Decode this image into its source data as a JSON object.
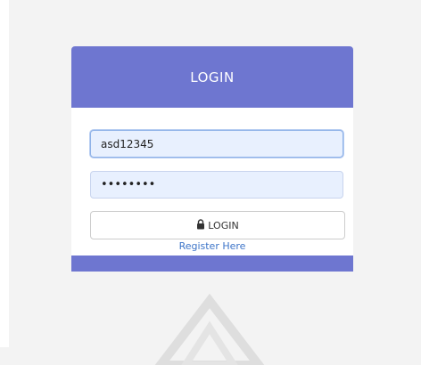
{
  "card": {
    "title": "LOGIN"
  },
  "form": {
    "username_value": "asd12345",
    "password_value": "••••••••",
    "login_label": "LOGIN",
    "register_label": "Register Here"
  },
  "colors": {
    "header": "#6e76d0",
    "input_bg": "#e8f0fe",
    "link": "#3c74c8"
  },
  "icons": {
    "button_icon": "lock-icon",
    "watermark": "triangle-watermark-icon"
  }
}
